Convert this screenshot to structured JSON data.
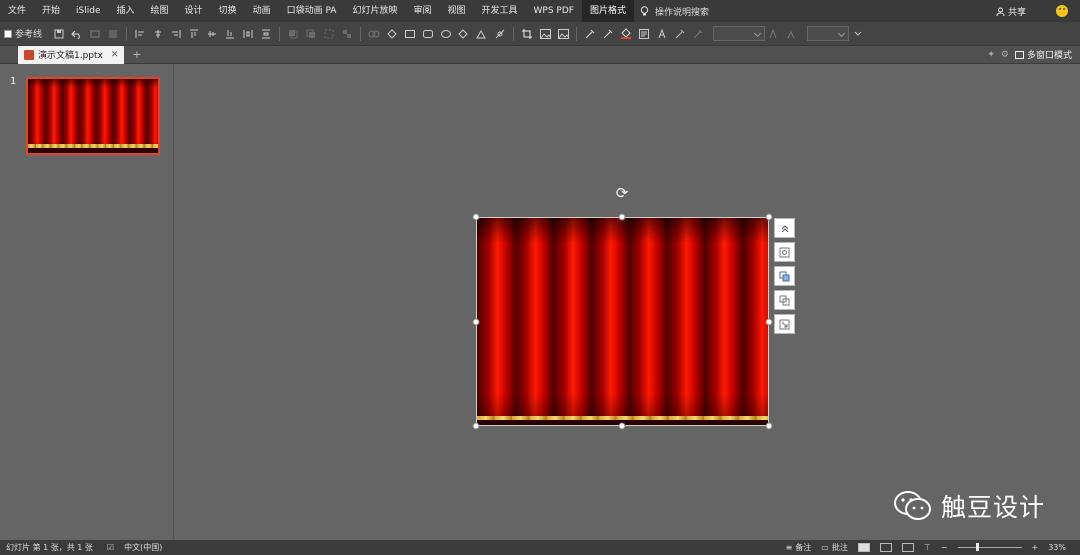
{
  "menu": {
    "items": [
      "文件",
      "开始",
      "iSlide",
      "插入",
      "绘图",
      "设计",
      "切换",
      "动画",
      "口袋动画 PA",
      "幻灯片放映",
      "审阅",
      "视图",
      "开发工具",
      "WPS PDF",
      "图片格式"
    ],
    "active_index": 14,
    "search_label": "操作说明搜索",
    "share_label": "共享"
  },
  "toolbar": {
    "guides_label": "参考线"
  },
  "tabs": {
    "doc_name": "演示文稿1.pptx",
    "multi_window_label": "多窗口模式"
  },
  "slides_panel": {
    "slide_number": "1"
  },
  "watermark": {
    "text": "触豆设计"
  },
  "status": {
    "slide_info": "幻灯片 第 1 张，共 1 张",
    "language": "中文(中国)",
    "notes_label": "备注",
    "comments_label": "批注",
    "zoom": "33%"
  },
  "colors": {
    "curtain_red": "#c00000",
    "fringe_gold": "#d4a73a",
    "selection_accent": "#e0452b"
  }
}
